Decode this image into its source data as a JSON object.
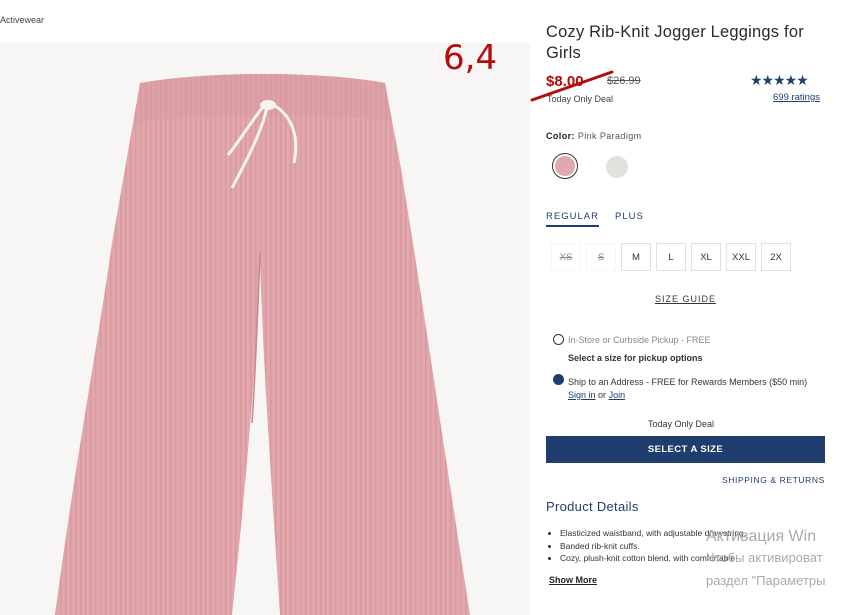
{
  "breadcrumb": "Activewear",
  "annotation_note": "6,4",
  "product": {
    "title": "Cozy Rib-Knit Jogger Leggings for Girls",
    "price": "$8.00",
    "original_price": "$26.99",
    "deal_label": "Today Only Deal",
    "stars": "★★★★★",
    "rating_value": 4.5,
    "ratings_link": "699 ratings"
  },
  "color": {
    "label": "Color:",
    "value": "Pink Paradigm",
    "swatches": [
      {
        "name": "Pink Paradigm",
        "hex": "#e1a8ad",
        "selected": true
      },
      {
        "name": "gray",
        "hex": "#e3e1de",
        "selected": false
      }
    ]
  },
  "fit_tabs": [
    {
      "label": "REGULAR",
      "active": true
    },
    {
      "label": "PLUS",
      "active": false
    }
  ],
  "sizes": [
    {
      "label": "XS",
      "available": false
    },
    {
      "label": "S",
      "available": false
    },
    {
      "label": "M",
      "available": true
    },
    {
      "label": "L",
      "available": true
    },
    {
      "label": "XL",
      "available": true
    },
    {
      "label": "XXL",
      "available": true
    },
    {
      "label": "2X",
      "available": true
    }
  ],
  "size_guide": "SIZE GUIDE",
  "fulfillment": {
    "pickup_label": "In-Store or Curbside Pickup - FREE",
    "pickup_hint": "Select a size for pickup options",
    "ship_text": "Ship to an Address - FREE for Rewards Members ($50 min)",
    "sign_in": "Sign in",
    "or": "or",
    "join": "Join"
  },
  "deal_repeat": "Today Only Deal",
  "cta_label": "SELECT A SIZE",
  "shipping_returns": "SHIPPING & RETURNS",
  "details": {
    "heading": "Product Details",
    "bullets": [
      "Elasticized waistband, with adjustable drawstring.",
      "Banded rib-knit cuffs.",
      "Cozy, plush-knit cotton blend, with comfortable"
    ],
    "show_more": "Show More"
  },
  "windows_watermark": {
    "line1": "Активация Win",
    "line2": "Чтобы активироват",
    "line3": "раздел \"Параметры"
  },
  "colors": {
    "navy": "#1f3e6e",
    "sale_red": "#b30c0c",
    "pants_pink": "#e1a8ad"
  }
}
